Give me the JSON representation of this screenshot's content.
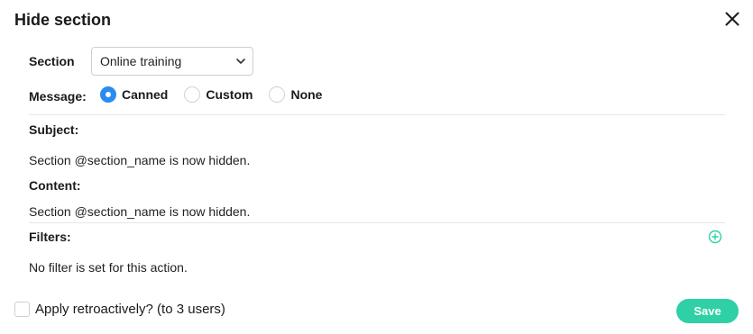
{
  "dialog": {
    "title": "Hide section"
  },
  "section": {
    "label": "Section",
    "selected": "Online training"
  },
  "message": {
    "label": "Message:",
    "options": [
      {
        "label": "Canned",
        "checked": true
      },
      {
        "label": "Custom",
        "checked": false
      },
      {
        "label": "None",
        "checked": false
      }
    ]
  },
  "subject": {
    "label": "Subject:",
    "value": "Section @section_name is now hidden."
  },
  "content": {
    "label": "Content:",
    "value": "Section @section_name is now hidden."
  },
  "filters": {
    "label": "Filters:",
    "empty_text": "No filter is set for this action."
  },
  "footer": {
    "retroactive_label": "Apply retroactively? (to 3 users)",
    "retroactive_checked": false,
    "save_label": "Save"
  },
  "colors": {
    "accent": "#2a8cf0",
    "save": "#2fd0a5"
  },
  "icons": [
    "close-icon",
    "chevron-down-icon",
    "add-circle-icon"
  ]
}
